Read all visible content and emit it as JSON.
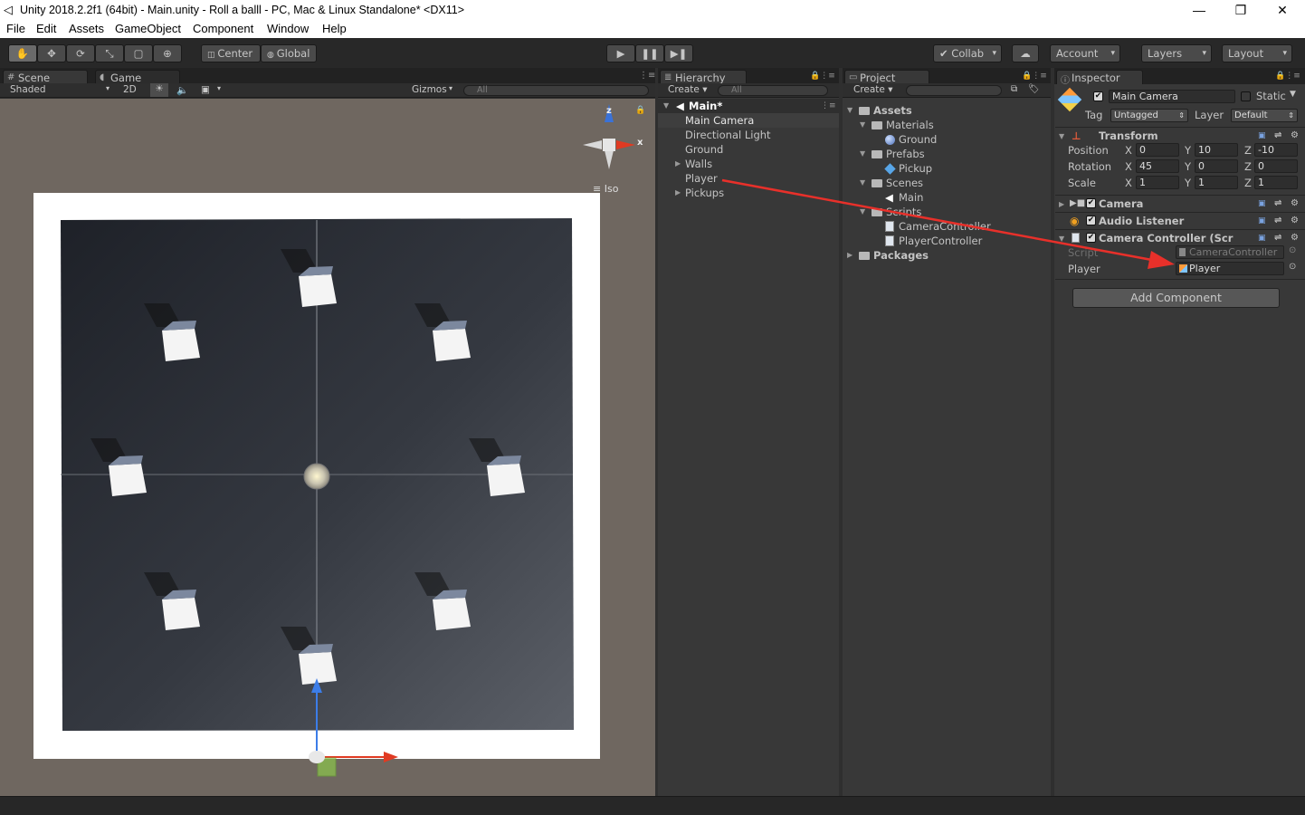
{
  "titlebar": {
    "title": "Unity 2018.2.2f1 (64bit) - Main.unity - Roll a balll - PC, Mac & Linux Standalone* <DX11>",
    "minimize": "—",
    "maximize": "❐",
    "close": "✕"
  },
  "menu": [
    "File",
    "Edit",
    "Assets",
    "GameObject",
    "Component",
    "Window",
    "Help"
  ],
  "toolbar": {
    "center": "Center",
    "global": "Global",
    "collab": "Collab",
    "account": "Account",
    "layers": "Layers",
    "layout": "Layout"
  },
  "scene": {
    "tab_scene": "Scene",
    "tab_game": "Game",
    "shaded": "Shaded",
    "mode2d": "2D",
    "gizmos": "Gizmos",
    "search": "All",
    "iso": "Iso",
    "axis_z": "z",
    "axis_x": "x"
  },
  "hierarchy": {
    "tab": "Hierarchy",
    "create": "Create",
    "search": "All",
    "scene": "Main*",
    "items": [
      "Main Camera",
      "Directional Light",
      "Ground",
      "Walls",
      "Player",
      "Pickups"
    ]
  },
  "project": {
    "tab": "Project",
    "create": "Create",
    "assets": "Assets",
    "materials": "Materials",
    "ground": "Ground",
    "prefabs": "Prefabs",
    "pickup": "Pickup",
    "scenes": "Scenes",
    "main": "Main",
    "scripts": "Scripts",
    "camera_controller": "CameraController",
    "player_controller": "PlayerController",
    "packages": "Packages"
  },
  "inspector": {
    "tab": "Inspector",
    "name": "Main Camera",
    "static": "Static",
    "tag_label": "Tag",
    "tag": "Untagged",
    "layer_label": "Layer",
    "layer": "Default",
    "transform": "Transform",
    "position_label": "Position",
    "rotation_label": "Rotation",
    "scale_label": "Scale",
    "x": "X",
    "y": "Y",
    "z": "Z",
    "position": {
      "x": "0",
      "y": "10",
      "z": "-10"
    },
    "rotation": {
      "x": "45",
      "y": "0",
      "z": "0"
    },
    "scale": {
      "x": "1",
      "y": "1",
      "z": "1"
    },
    "camera": "Camera",
    "audio_listener": "Audio Listener",
    "camera_controller": "Camera Controller (Scr",
    "script_label": "Script",
    "script_value": "CameraController",
    "player_label": "Player",
    "player_value": "Player",
    "add_component": "Add Component"
  },
  "colors": {
    "accent_arrow": "#e8302a",
    "selection": "#3e3e3e",
    "panel": "#383838"
  }
}
